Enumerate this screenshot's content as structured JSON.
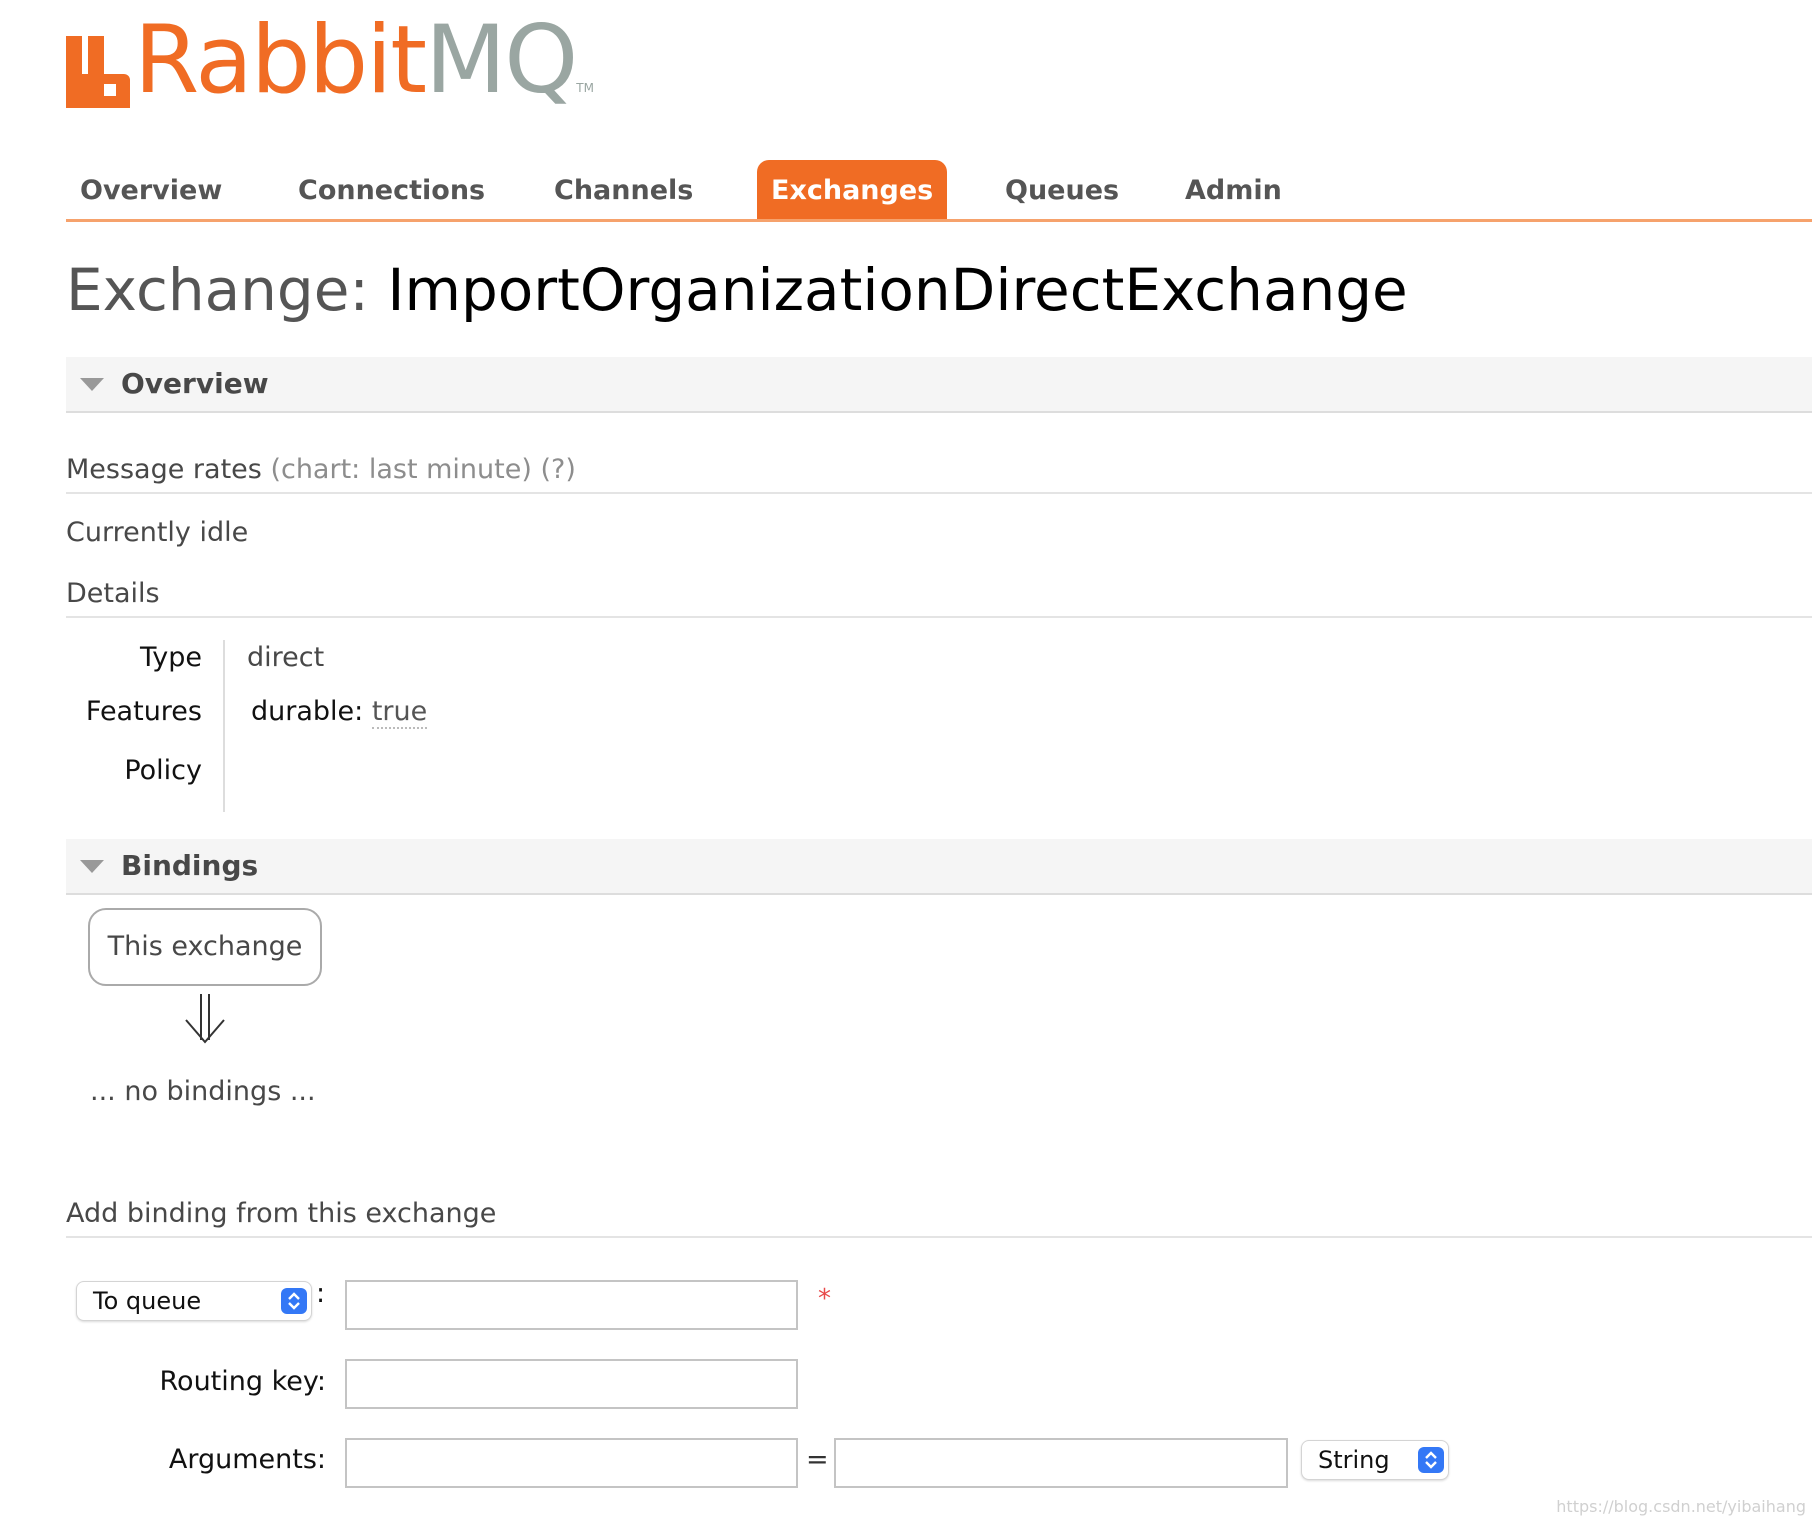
{
  "logo": {
    "brand_part1": "Rabbit",
    "brand_part2": "MQ",
    "trademark": "TM",
    "brand_color": "#f06c24"
  },
  "nav": {
    "tabs": [
      {
        "label": "Overview",
        "active": false
      },
      {
        "label": "Connections",
        "active": false
      },
      {
        "label": "Channels",
        "active": false
      },
      {
        "label": "Exchanges",
        "active": true
      },
      {
        "label": "Queues",
        "active": false
      },
      {
        "label": "Admin",
        "active": false
      }
    ]
  },
  "page": {
    "title_prefix": "Exchange:",
    "exchange_name": "ImportOrganizationDirectExchange"
  },
  "overview": {
    "header": "Overview",
    "message_rates_label": "Message rates",
    "chart_range_link": "(chart: last minute)",
    "help_link": "(?)",
    "status_text": "Currently idle",
    "details_heading": "Details",
    "details": {
      "type_label": "Type",
      "type_value": "direct",
      "features_label": "Features",
      "durable_key": "durable:",
      "durable_value": "true",
      "policy_label": "Policy",
      "policy_value": ""
    }
  },
  "bindings": {
    "header": "Bindings",
    "source_box": "This exchange",
    "arrow_icon": "double-down-arrow-icon",
    "empty_text": "... no bindings ..."
  },
  "add_binding": {
    "heading": "Add binding from this exchange",
    "destination_type": "To queue",
    "colon": ":",
    "destination_value": "",
    "required_marker": "*",
    "routing_key_label": "Routing key:",
    "routing_key_value": "",
    "arguments_label": "Arguments:",
    "arg_key": "",
    "equals": "=",
    "arg_value": "",
    "arg_type": "String",
    "accent_color": "#3478f6"
  },
  "watermark": "https://blog.csdn.net/yibaihang"
}
